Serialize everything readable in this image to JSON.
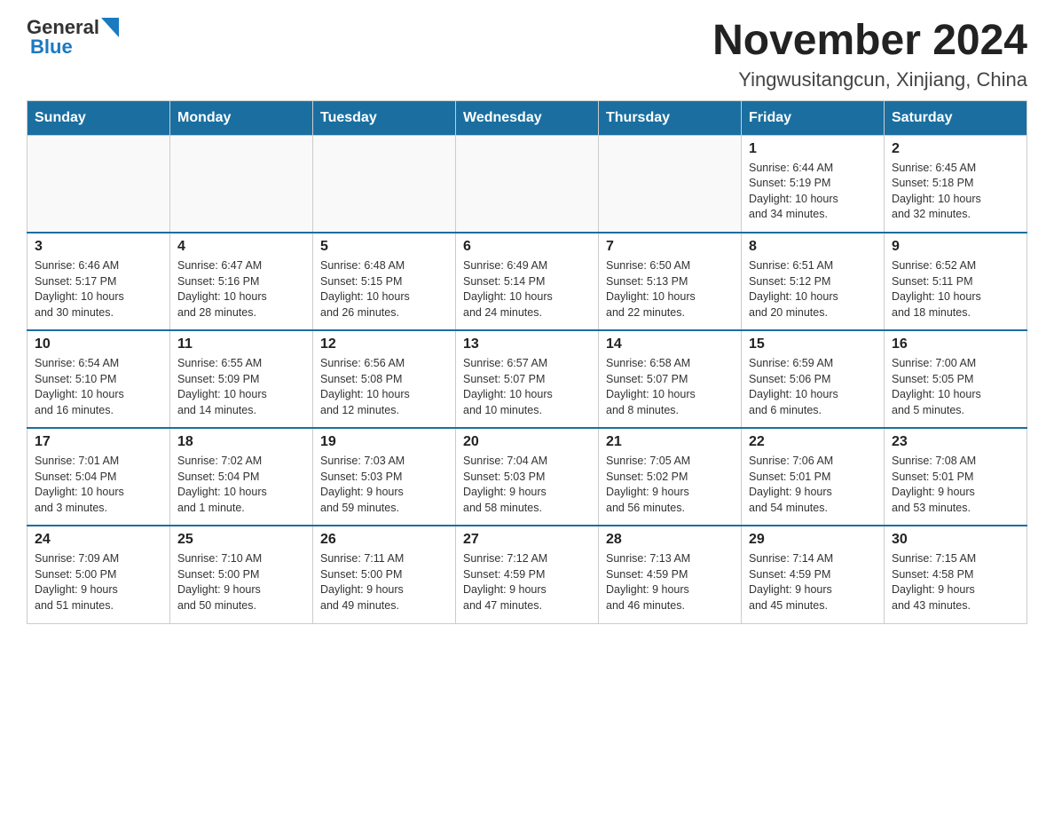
{
  "logo": {
    "general": "General",
    "blue": "Blue"
  },
  "title": "November 2024",
  "location": "Yingwusitangcun, Xinjiang, China",
  "weekdays": [
    "Sunday",
    "Monday",
    "Tuesday",
    "Wednesday",
    "Thursday",
    "Friday",
    "Saturday"
  ],
  "weeks": [
    [
      {
        "day": "",
        "info": ""
      },
      {
        "day": "",
        "info": ""
      },
      {
        "day": "",
        "info": ""
      },
      {
        "day": "",
        "info": ""
      },
      {
        "day": "",
        "info": ""
      },
      {
        "day": "1",
        "info": "Sunrise: 6:44 AM\nSunset: 5:19 PM\nDaylight: 10 hours\nand 34 minutes."
      },
      {
        "day": "2",
        "info": "Sunrise: 6:45 AM\nSunset: 5:18 PM\nDaylight: 10 hours\nand 32 minutes."
      }
    ],
    [
      {
        "day": "3",
        "info": "Sunrise: 6:46 AM\nSunset: 5:17 PM\nDaylight: 10 hours\nand 30 minutes."
      },
      {
        "day": "4",
        "info": "Sunrise: 6:47 AM\nSunset: 5:16 PM\nDaylight: 10 hours\nand 28 minutes."
      },
      {
        "day": "5",
        "info": "Sunrise: 6:48 AM\nSunset: 5:15 PM\nDaylight: 10 hours\nand 26 minutes."
      },
      {
        "day": "6",
        "info": "Sunrise: 6:49 AM\nSunset: 5:14 PM\nDaylight: 10 hours\nand 24 minutes."
      },
      {
        "day": "7",
        "info": "Sunrise: 6:50 AM\nSunset: 5:13 PM\nDaylight: 10 hours\nand 22 minutes."
      },
      {
        "day": "8",
        "info": "Sunrise: 6:51 AM\nSunset: 5:12 PM\nDaylight: 10 hours\nand 20 minutes."
      },
      {
        "day": "9",
        "info": "Sunrise: 6:52 AM\nSunset: 5:11 PM\nDaylight: 10 hours\nand 18 minutes."
      }
    ],
    [
      {
        "day": "10",
        "info": "Sunrise: 6:54 AM\nSunset: 5:10 PM\nDaylight: 10 hours\nand 16 minutes."
      },
      {
        "day": "11",
        "info": "Sunrise: 6:55 AM\nSunset: 5:09 PM\nDaylight: 10 hours\nand 14 minutes."
      },
      {
        "day": "12",
        "info": "Sunrise: 6:56 AM\nSunset: 5:08 PM\nDaylight: 10 hours\nand 12 minutes."
      },
      {
        "day": "13",
        "info": "Sunrise: 6:57 AM\nSunset: 5:07 PM\nDaylight: 10 hours\nand 10 minutes."
      },
      {
        "day": "14",
        "info": "Sunrise: 6:58 AM\nSunset: 5:07 PM\nDaylight: 10 hours\nand 8 minutes."
      },
      {
        "day": "15",
        "info": "Sunrise: 6:59 AM\nSunset: 5:06 PM\nDaylight: 10 hours\nand 6 minutes."
      },
      {
        "day": "16",
        "info": "Sunrise: 7:00 AM\nSunset: 5:05 PM\nDaylight: 10 hours\nand 5 minutes."
      }
    ],
    [
      {
        "day": "17",
        "info": "Sunrise: 7:01 AM\nSunset: 5:04 PM\nDaylight: 10 hours\nand 3 minutes."
      },
      {
        "day": "18",
        "info": "Sunrise: 7:02 AM\nSunset: 5:04 PM\nDaylight: 10 hours\nand 1 minute."
      },
      {
        "day": "19",
        "info": "Sunrise: 7:03 AM\nSunset: 5:03 PM\nDaylight: 9 hours\nand 59 minutes."
      },
      {
        "day": "20",
        "info": "Sunrise: 7:04 AM\nSunset: 5:03 PM\nDaylight: 9 hours\nand 58 minutes."
      },
      {
        "day": "21",
        "info": "Sunrise: 7:05 AM\nSunset: 5:02 PM\nDaylight: 9 hours\nand 56 minutes."
      },
      {
        "day": "22",
        "info": "Sunrise: 7:06 AM\nSunset: 5:01 PM\nDaylight: 9 hours\nand 54 minutes."
      },
      {
        "day": "23",
        "info": "Sunrise: 7:08 AM\nSunset: 5:01 PM\nDaylight: 9 hours\nand 53 minutes."
      }
    ],
    [
      {
        "day": "24",
        "info": "Sunrise: 7:09 AM\nSunset: 5:00 PM\nDaylight: 9 hours\nand 51 minutes."
      },
      {
        "day": "25",
        "info": "Sunrise: 7:10 AM\nSunset: 5:00 PM\nDaylight: 9 hours\nand 50 minutes."
      },
      {
        "day": "26",
        "info": "Sunrise: 7:11 AM\nSunset: 5:00 PM\nDaylight: 9 hours\nand 49 minutes."
      },
      {
        "day": "27",
        "info": "Sunrise: 7:12 AM\nSunset: 4:59 PM\nDaylight: 9 hours\nand 47 minutes."
      },
      {
        "day": "28",
        "info": "Sunrise: 7:13 AM\nSunset: 4:59 PM\nDaylight: 9 hours\nand 46 minutes."
      },
      {
        "day": "29",
        "info": "Sunrise: 7:14 AM\nSunset: 4:59 PM\nDaylight: 9 hours\nand 45 minutes."
      },
      {
        "day": "30",
        "info": "Sunrise: 7:15 AM\nSunset: 4:58 PM\nDaylight: 9 hours\nand 43 minutes."
      }
    ]
  ]
}
